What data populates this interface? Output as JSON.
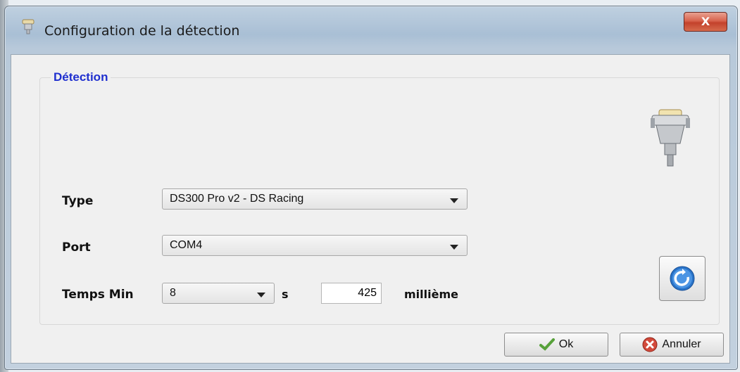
{
  "window": {
    "title": "Configuration de la détection",
    "close_label": "X"
  },
  "group": {
    "title": "Détection"
  },
  "form": {
    "type_label": "Type",
    "type_value": "DS300 Pro v2 - DS Racing",
    "port_label": "Port",
    "port_value": "COM4",
    "temps_label": "Temps Min",
    "seconds_value": "8",
    "seconds_unit": "s",
    "millis_value": "425",
    "millis_unit": "millième"
  },
  "buttons": {
    "ok_label": "Ok",
    "cancel_label": "Annuler"
  },
  "icons": {
    "title": "serial-connector-icon",
    "device": "serial-connector-icon",
    "refresh": "refresh-icon",
    "ok": "checkmark-icon",
    "cancel": "cancel-icon"
  },
  "colors": {
    "group_title": "#1f2fcf",
    "close_button": "#c94a35",
    "refresh_blue": "#2a74c9"
  }
}
